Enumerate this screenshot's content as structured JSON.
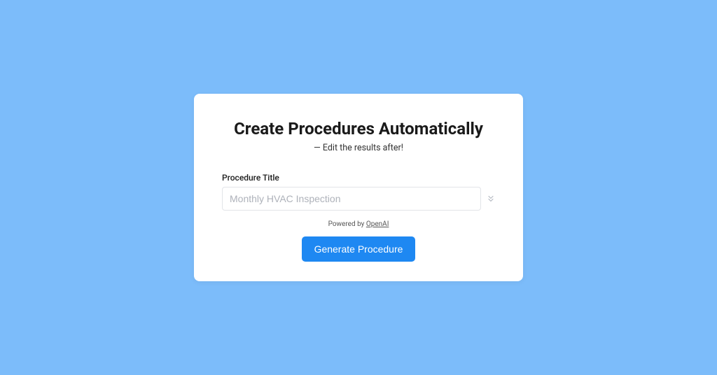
{
  "card": {
    "title": "Create Procedures Automatically",
    "subtitle": "— Edit the results after!",
    "form": {
      "title_label": "Procedure Title",
      "title_placeholder": "Monthly HVAC Inspection",
      "title_value": ""
    },
    "powered_prefix": "Powered by ",
    "powered_link_text": "OpenAI",
    "button_label": "Generate Procedure"
  },
  "colors": {
    "background": "#7cbcfa",
    "primary": "#1e88f2"
  }
}
